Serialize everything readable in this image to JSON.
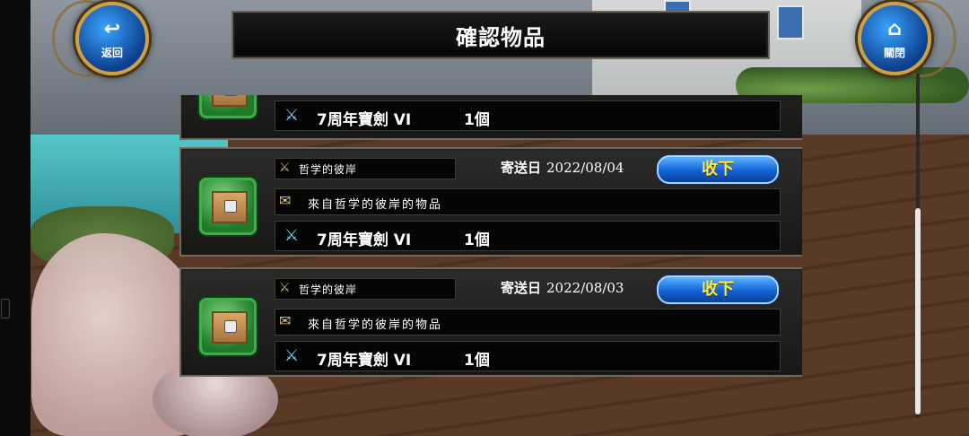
{
  "header": {
    "title": "確認物品"
  },
  "nav": {
    "back_label": "返回",
    "back_icon": "↩",
    "close_label": "關閉",
    "close_icon": "⌂"
  },
  "mail_partial": {
    "reward_name": "7周年寶劍 VI",
    "reward_qty": "1個"
  },
  "mails": [
    {
      "sender": "哲学的彼岸",
      "date_label": "寄送日",
      "date": "2022/08/04",
      "accept_label": "收下",
      "message": "來自哲学的彼岸的物品",
      "reward_name": "7周年寶劍 VI",
      "reward_qty": "1個"
    },
    {
      "sender": "哲学的彼岸",
      "date_label": "寄送日",
      "date": "2022/08/03",
      "accept_label": "收下",
      "message": "來自哲学的彼岸的物品",
      "reward_name": "7周年寶劍 VI",
      "reward_qty": "1個"
    }
  ],
  "colors": {
    "accept_text": "#ffea3a",
    "accept_bg": "#1262d6",
    "item_frame": "#3fae4a",
    "panel_border": "#6f6a60"
  },
  "icons": {
    "sender": "sword-crossed-icon",
    "message": "scroll-icon",
    "reward": "sword-icon",
    "item": "gift-box-icon"
  }
}
